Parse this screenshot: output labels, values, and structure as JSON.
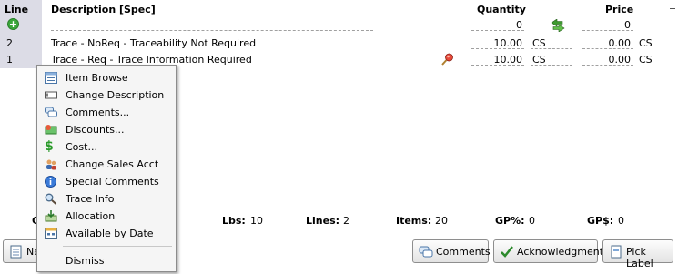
{
  "header": {
    "line": "Line",
    "description": "Description [Spec]",
    "quantity": "Quantity",
    "price": "Price"
  },
  "new_row": {
    "quantity": "0",
    "price": "0"
  },
  "rows": [
    {
      "line": "2",
      "description": "Trace - NoReq - Traceability Not Required",
      "quantity": "10.00",
      "uom": "CS",
      "price": "0.00",
      "price_uom": "CS"
    },
    {
      "line": "1",
      "description": "Trace - Req - Trace Information Required",
      "quantity": "10.00",
      "uom": "CS",
      "price": "0.00",
      "price_uom": "CS"
    }
  ],
  "totals": {
    "c_label": "C",
    "lbs_label": "Lbs:",
    "lbs": "10",
    "lines_label": "Lines:",
    "lines": "2",
    "items_label": "Items:",
    "items": "20",
    "gp_pct_label": "GP%:",
    "gp_pct": "0",
    "gp_amt_label": "GP$:",
    "gp_amt": "0"
  },
  "menu": {
    "items": [
      {
        "label": "Item Browse",
        "icon": "browse-icon"
      },
      {
        "label": "Change Description",
        "icon": "description-icon"
      },
      {
        "label": "Comments...",
        "icon": "comments-icon"
      },
      {
        "label": "Discounts...",
        "icon": "discount-icon"
      },
      {
        "label": "Cost...",
        "icon": "dollar-icon"
      },
      {
        "label": "Change Sales Acct",
        "icon": "users-icon"
      },
      {
        "label": "Special Comments",
        "icon": "info-icon"
      },
      {
        "label": "Trace Info",
        "icon": "magnifier-icon"
      },
      {
        "label": "Allocation",
        "icon": "allocation-icon"
      },
      {
        "label": "Available by Date",
        "icon": "calendar-icon"
      }
    ],
    "dismiss": "Dismiss"
  },
  "buttons": {
    "new_partial": "Ne",
    "comments": "Comments",
    "acknowledgment": "Acknowledgment",
    "pick_label": "Pick Label"
  },
  "colors": {
    "line_column": "#dcdce6",
    "menu_bg": "#f5f5f5"
  }
}
